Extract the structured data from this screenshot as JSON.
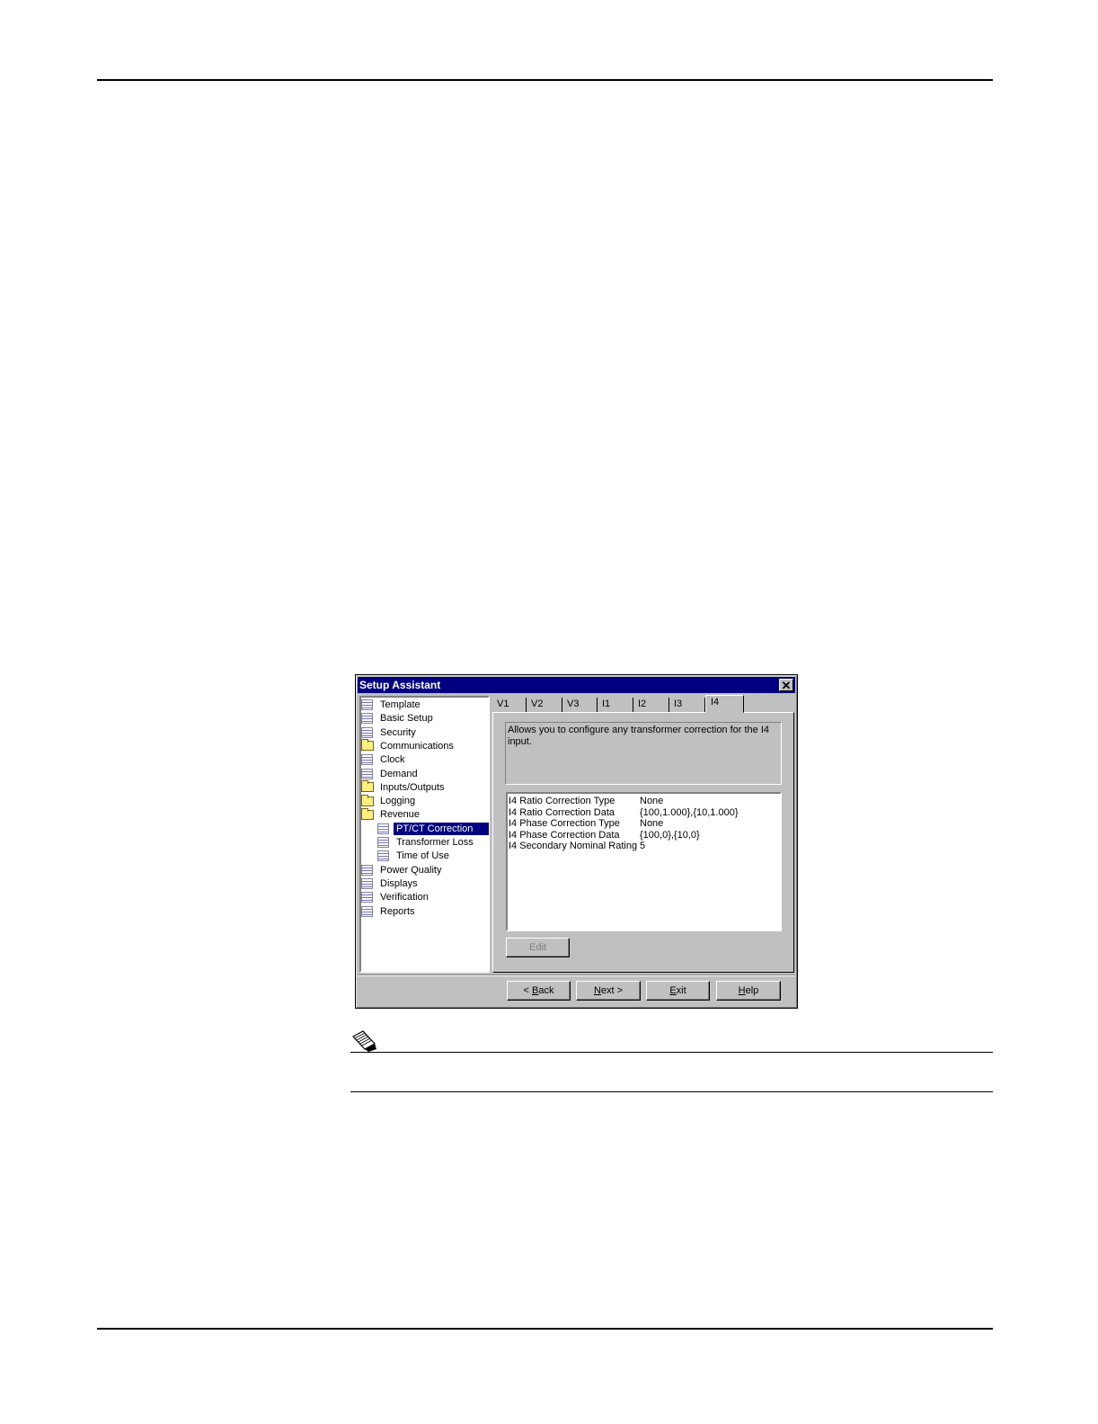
{
  "window": {
    "title": "Setup Assistant",
    "close_glyph": "✕"
  },
  "tree": {
    "items": [
      {
        "label": "Template",
        "icon": "document-icon"
      },
      {
        "label": "Basic Setup",
        "icon": "document-icon"
      },
      {
        "label": "Security",
        "icon": "document-icon"
      },
      {
        "label": "Communications",
        "icon": "folder-icon"
      },
      {
        "label": "Clock",
        "icon": "document-icon"
      },
      {
        "label": "Demand",
        "icon": "document-icon"
      },
      {
        "label": "Inputs/Outputs",
        "icon": "folder-icon"
      },
      {
        "label": "Logging",
        "icon": "folder-icon"
      },
      {
        "label": "Revenue",
        "icon": "folder-icon"
      },
      {
        "label": "PT/CT Correction",
        "icon": "document-icon",
        "selected": true
      },
      {
        "label": "Transformer Loss",
        "icon": "document-icon"
      },
      {
        "label": "Time of Use",
        "icon": "document-icon"
      },
      {
        "label": "Power Quality",
        "icon": "document-icon"
      },
      {
        "label": "Displays",
        "icon": "document-icon"
      },
      {
        "label": "Verification",
        "icon": "document-icon"
      },
      {
        "label": "Reports",
        "icon": "document-icon"
      }
    ]
  },
  "tabs": [
    "V1",
    "V2",
    "V3",
    "I1",
    "I2",
    "I3",
    "I4"
  ],
  "active_tab": "I4",
  "description": "Allows you to configure any transformer correction for the I4 input.",
  "parameters": [
    {
      "name": "I4 Ratio Correction Type",
      "value": "None"
    },
    {
      "name": "I4 Ratio Correction Data",
      "value": "{100,1.000},{10,1.000}"
    },
    {
      "name": "I4 Phase Correction Type",
      "value": "None"
    },
    {
      "name": "I4 Phase Correction Data",
      "value": "{100,0},{10,0}"
    },
    {
      "name": "I4 Secondary Nominal Rating",
      "value": "5"
    }
  ],
  "buttons": {
    "edit": "Edit",
    "back_prefix": "< ",
    "back_key": "B",
    "back_rest": "ack",
    "next_key": "N",
    "next_rest": "ext >",
    "exit_key": "E",
    "exit_rest": "xit",
    "help_key": "H",
    "help_rest": "elp"
  }
}
